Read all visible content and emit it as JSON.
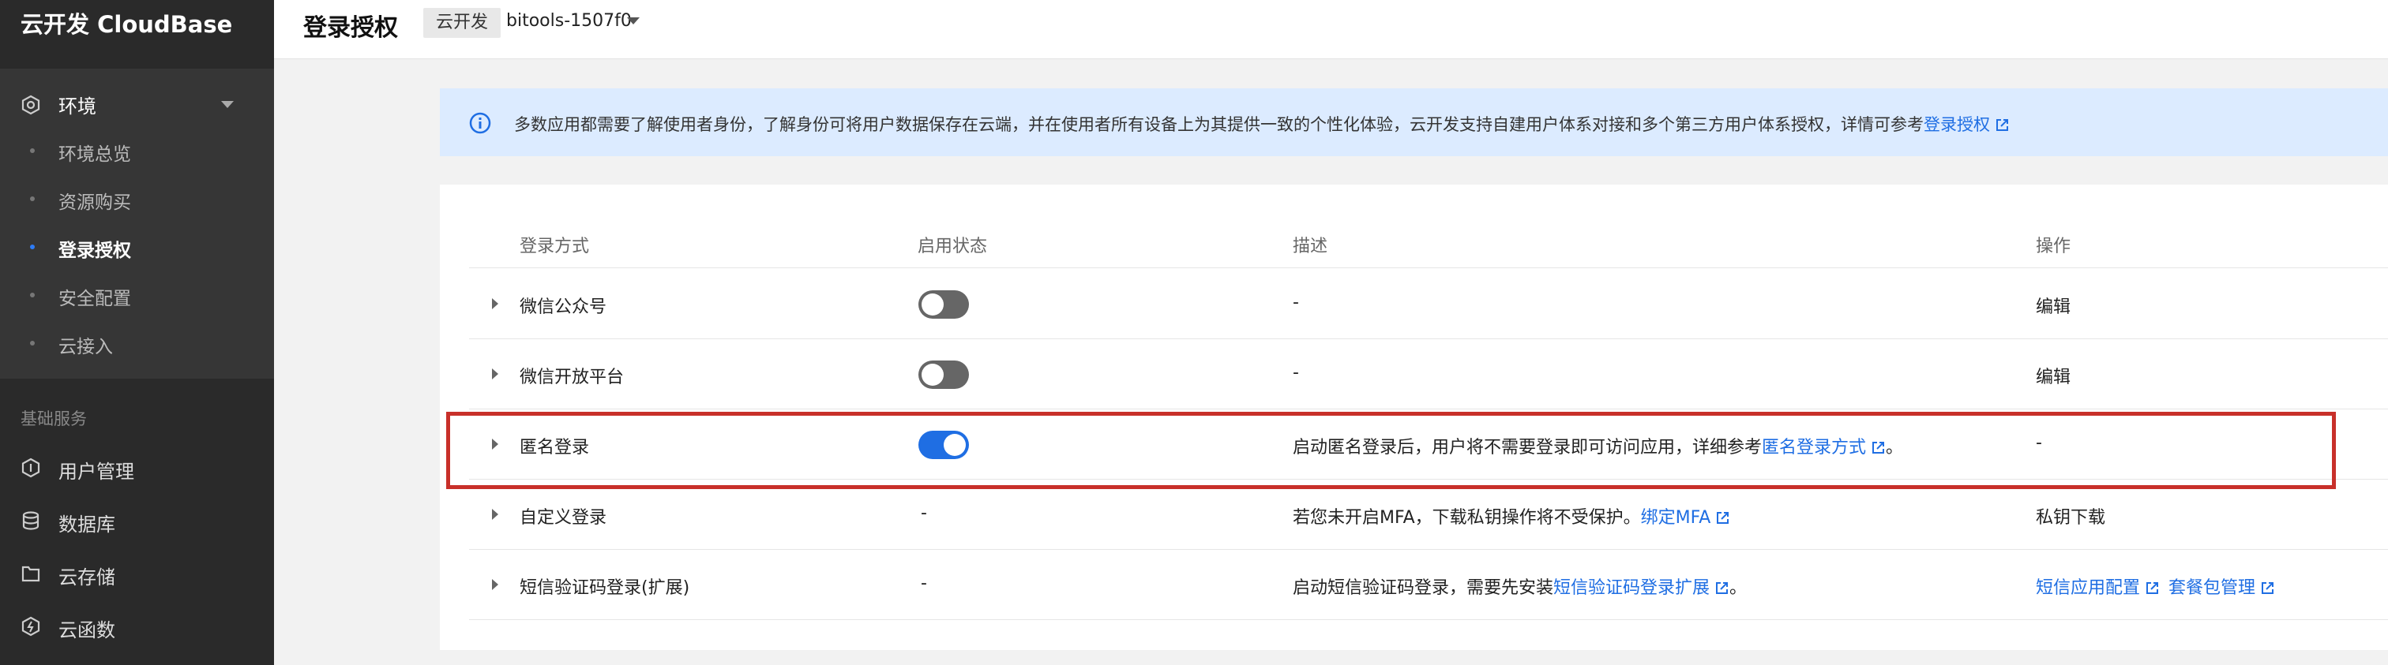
{
  "sidebar": {
    "brand": "云开发 CloudBase",
    "env_group": {
      "label": "环境",
      "items": [
        {
          "label": "环境总览",
          "active": false
        },
        {
          "label": "资源购买",
          "active": false
        },
        {
          "label": "登录授权",
          "active": true
        },
        {
          "label": "安全配置",
          "active": false
        },
        {
          "label": "云接入",
          "active": false
        }
      ]
    },
    "section_label": "基础服务",
    "nav": [
      {
        "label": "用户管理",
        "icon": "user-manage-icon"
      },
      {
        "label": "数据库",
        "icon": "database-icon"
      },
      {
        "label": "云存储",
        "icon": "folder-icon"
      },
      {
        "label": "云函数",
        "icon": "function-icon"
      }
    ]
  },
  "header": {
    "title": "登录授权",
    "env_tag": "云开发",
    "env_name": "bitools-1507f0"
  },
  "notice": {
    "text": "多数应用都需要了解使用者身份，了解身份可将用户数据保存在云端，并在使用者所有设备上为其提供一致的个性化体验，云开发支持自建用户体系对接和多个第三方用户体系授权，详情可参考",
    "link": "登录授权"
  },
  "table": {
    "headers": [
      "登录方式",
      "启用状态",
      "描述",
      "操作"
    ],
    "rows": [
      {
        "method": "微信公众号",
        "status": "toggle-off",
        "desc": "-",
        "desc_link": "",
        "desc_suffix": "",
        "actions": [
          {
            "label": "编辑",
            "external": false
          }
        ]
      },
      {
        "method": "微信开放平台",
        "status": "toggle-off",
        "desc": "-",
        "desc_link": "",
        "desc_suffix": "",
        "actions": [
          {
            "label": "编辑",
            "external": false
          }
        ]
      },
      {
        "method": "匿名登录",
        "status": "toggle-on",
        "desc": "启动匿名登录后，用户将不需要登录即可访问应用，详细参考",
        "desc_link": "匿名登录方式",
        "desc_suffix": "。",
        "actions": [
          {
            "label": "-",
            "external": false,
            "plain": true
          }
        ]
      },
      {
        "method": "自定义登录",
        "status": "-",
        "desc": "若您未开启MFA，下载私钥操作将不受保护。",
        "desc_link": "绑定MFA",
        "desc_suffix": "",
        "actions": [
          {
            "label": "私钥下载",
            "external": false
          }
        ]
      },
      {
        "method": "短信验证码登录(扩展)",
        "status": "-",
        "desc": "启动短信验证码登录，需要先安装",
        "desc_link": "短信验证码登录扩展",
        "desc_suffix": "。",
        "actions": [
          {
            "label": "短信应用配置",
            "external": true
          },
          {
            "label": "套餐包管理",
            "external": true
          }
        ]
      }
    ]
  },
  "colors": {
    "sidebar_bg": "#2a2a2a",
    "accent": "#1f6ee3",
    "notice_bg": "#dcebff",
    "highlight": "#c8302a"
  }
}
